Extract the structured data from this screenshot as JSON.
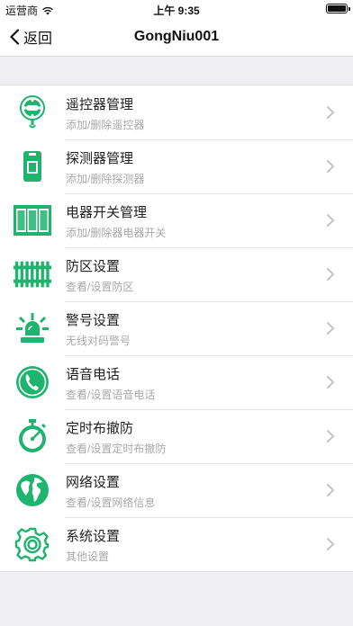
{
  "status_bar": {
    "carrier": "运营商",
    "time": "上午 9:35"
  },
  "nav": {
    "back_label": "返回",
    "title": "GongNiu001"
  },
  "accent_color": "#1fb46e",
  "menu": [
    {
      "title": "遥控器管理",
      "subtitle": "添加/删除遥控器",
      "icon": "remote-icon"
    },
    {
      "title": "探测器管理",
      "subtitle": "添加/删除探测器",
      "icon": "detector-icon"
    },
    {
      "title": "电器开关管理",
      "subtitle": "添加/删除器电器开关",
      "icon": "switch-panel-icon"
    },
    {
      "title": "防区设置",
      "subtitle": "查看/设置防区",
      "icon": "fence-icon"
    },
    {
      "title": "警号设置",
      "subtitle": "无线对码警号",
      "icon": "siren-icon"
    },
    {
      "title": "语音电话",
      "subtitle": "查看/设置语音电话",
      "icon": "phone-icon"
    },
    {
      "title": "定时布撤防",
      "subtitle": "查看/设置定时布撤防",
      "icon": "stopwatch-icon"
    },
    {
      "title": "网络设置",
      "subtitle": "查看/设置网络信息",
      "icon": "globe-icon"
    },
    {
      "title": "系统设置",
      "subtitle": "其他设置",
      "icon": "gear-icon"
    }
  ]
}
